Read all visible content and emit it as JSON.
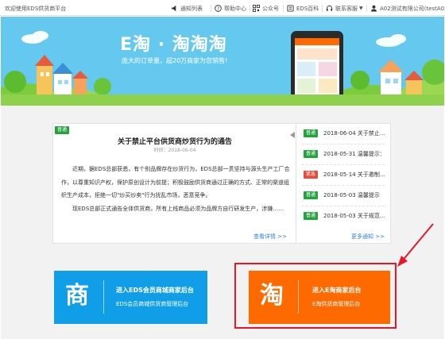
{
  "topbar": {
    "welcome": "欢迎使用EDS供货商平台",
    "nav": [
      {
        "label": "通知列表",
        "icon": "megaphone-icon"
      },
      {
        "label": "帮助中心",
        "icon": "help-icon"
      },
      {
        "label": "公众号",
        "icon": "qrcode-icon"
      },
      {
        "label": "EDS百科",
        "icon": "book-icon"
      },
      {
        "label": "联系客服",
        "icon": "headset-icon"
      },
      {
        "label": "A02测试有限公司(testA02)",
        "icon": "user-icon"
      }
    ]
  },
  "banner": {
    "title": "E淘 · 淘淘淘",
    "subtitle": "庞大的订单量，超20万商家为您销售!"
  },
  "article": {
    "tag": "普通",
    "title": "关于禁止平台供货商炒货行为的通告",
    "time": "时间：2018-06-04",
    "paragraphs": [
      "近期，据EDS总部获悉，有个别品牌存在炒货行为，EDS总部一贯坚持与源头生产工厂合作，以尊重知识产权，保护原创设计为前提；积极鼓励供货商通过正确的方式、正常的渠道组织生产成本，拒绝一切\"炒买炒卖\"行为扰乱市场，恶意竞争。",
      "现EDS总部正式通告全体供货商，所有上线商品必须为品牌方自行研发生产，涉嫌……"
    ],
    "detail_link": "查看详情 >>"
  },
  "news": {
    "items": [
      {
        "tag": "普通",
        "type": "green",
        "text": "2018-06-04 关于禁止..."
      },
      {
        "tag": "普通",
        "type": "green",
        "text": "2018-05-31 温馨提示："
      },
      {
        "tag": "紧急",
        "type": "red",
        "text": "2018-05-14 关于邀制..."
      },
      {
        "tag": "普通",
        "type": "green",
        "text": "2018-05-03 温馨提示"
      },
      {
        "tag": "普通",
        "type": "green",
        "text": "2018-05-03 关于规范..."
      }
    ],
    "more_link": "更多通知 >>"
  },
  "entries": {
    "mall": {
      "glyph": "商",
      "title": "进入EDS会员商城商家后台",
      "subtitle": "EDS会员商城供货商管理后台"
    },
    "etao": {
      "glyph": "淘",
      "title": "进入E淘商家后台",
      "subtitle": "E淘供货商管理后台"
    }
  },
  "colors": {
    "banner": "#64c8ef",
    "mall_card": "#119ee8",
    "etao_card": "#ff6a00",
    "highlight": "#e5182a",
    "link": "#2f7fd8",
    "tag_normal": "#22a33c",
    "tag_urgent": "#e64b3b"
  }
}
